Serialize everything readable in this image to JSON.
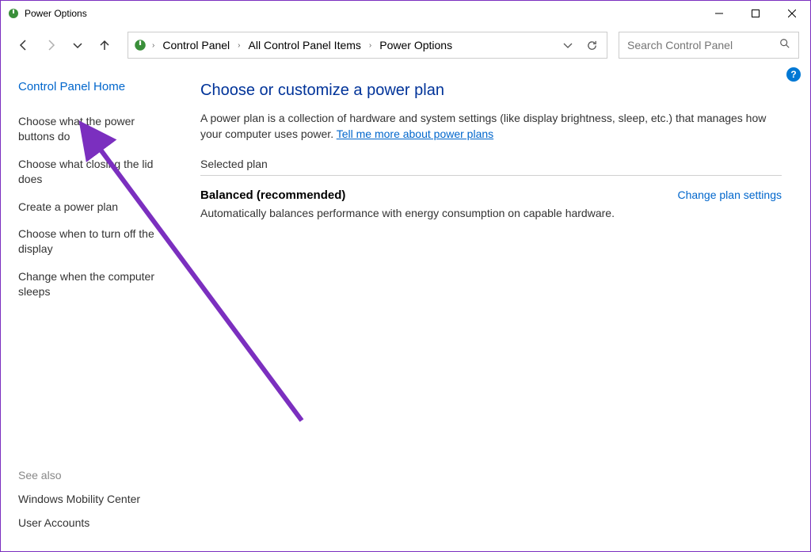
{
  "window": {
    "title": "Power Options"
  },
  "breadcrumbs": {
    "items": [
      "Control Panel",
      "All Control Panel Items",
      "Power Options"
    ]
  },
  "search": {
    "placeholder": "Search Control Panel"
  },
  "sidebar": {
    "home": "Control Panel Home",
    "links": [
      "Choose what the power buttons do",
      "Choose what closing the lid does",
      "Create a power plan",
      "Choose when to turn off the display",
      "Change when the computer sleeps"
    ],
    "see_also_label": "See also",
    "see_also": [
      "Windows Mobility Center",
      "User Accounts"
    ]
  },
  "main": {
    "heading": "Choose or customize a power plan",
    "description_text": "A power plan is a collection of hardware and system settings (like display brightness, sleep, etc.) that manages how your computer uses power. ",
    "description_link": "Tell me more about power plans",
    "section_label": "Selected plan",
    "plan_name": "Balanced (recommended)",
    "change_link": "Change plan settings",
    "plan_desc": "Automatically balances performance with energy consumption on capable hardware."
  },
  "help_badge": "?"
}
